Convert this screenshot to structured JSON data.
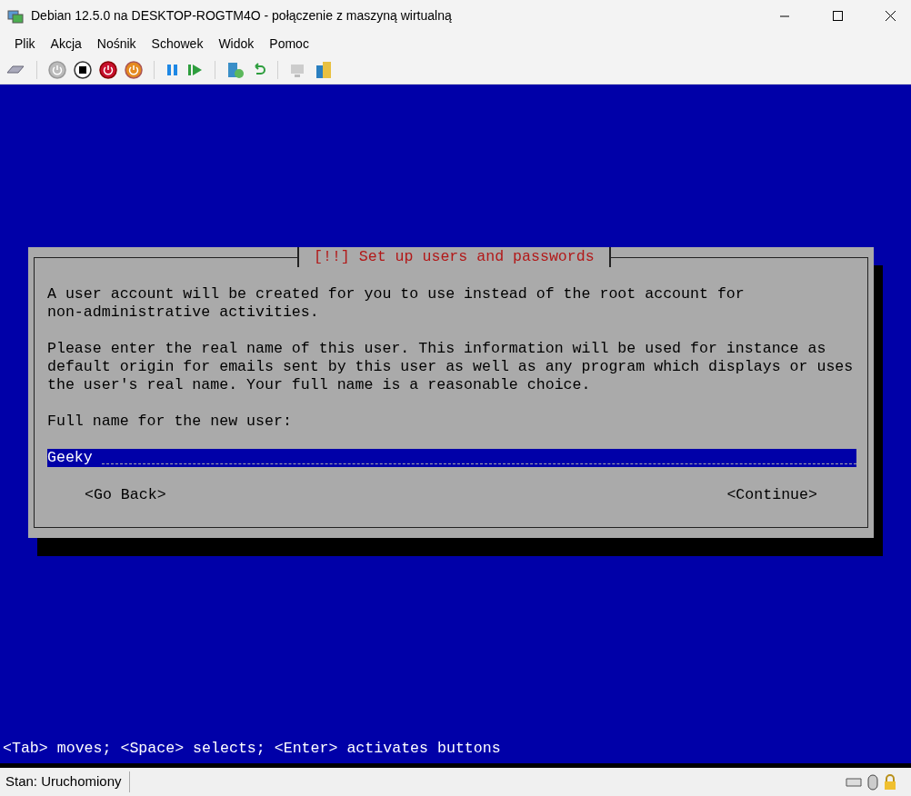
{
  "window": {
    "title": "Debian 12.5.0 na DESKTOP-ROGTM4O - połączenie z maszyną wirtualną"
  },
  "menu": [
    "Plik",
    "Akcja",
    "Nośnik",
    "Schowek",
    "Widok",
    "Pomoc"
  ],
  "dialog": {
    "title": "[!!] Set up users and passwords",
    "paragraphs": [
      [
        "A user account will be created for you to use instead of the root account for",
        "non-administrative activities."
      ],
      [
        "Please enter the real name of this user. This information will be used for instance as",
        "default origin for emails sent by this user as well as any program which displays or uses",
        "the user's real name. Your full name is a reasonable choice."
      ]
    ],
    "field_label": "Full name for the new user:",
    "field_value": "Geeky",
    "buttons": [
      {
        "label": "<Go Back>",
        "selected": false
      },
      {
        "label": "<Continue>",
        "selected": false
      }
    ]
  },
  "help_line": "<Tab> moves; <Space> selects; <Enter> activates buttons",
  "status_bar": {
    "text": "Stan: Uruchomiony"
  }
}
